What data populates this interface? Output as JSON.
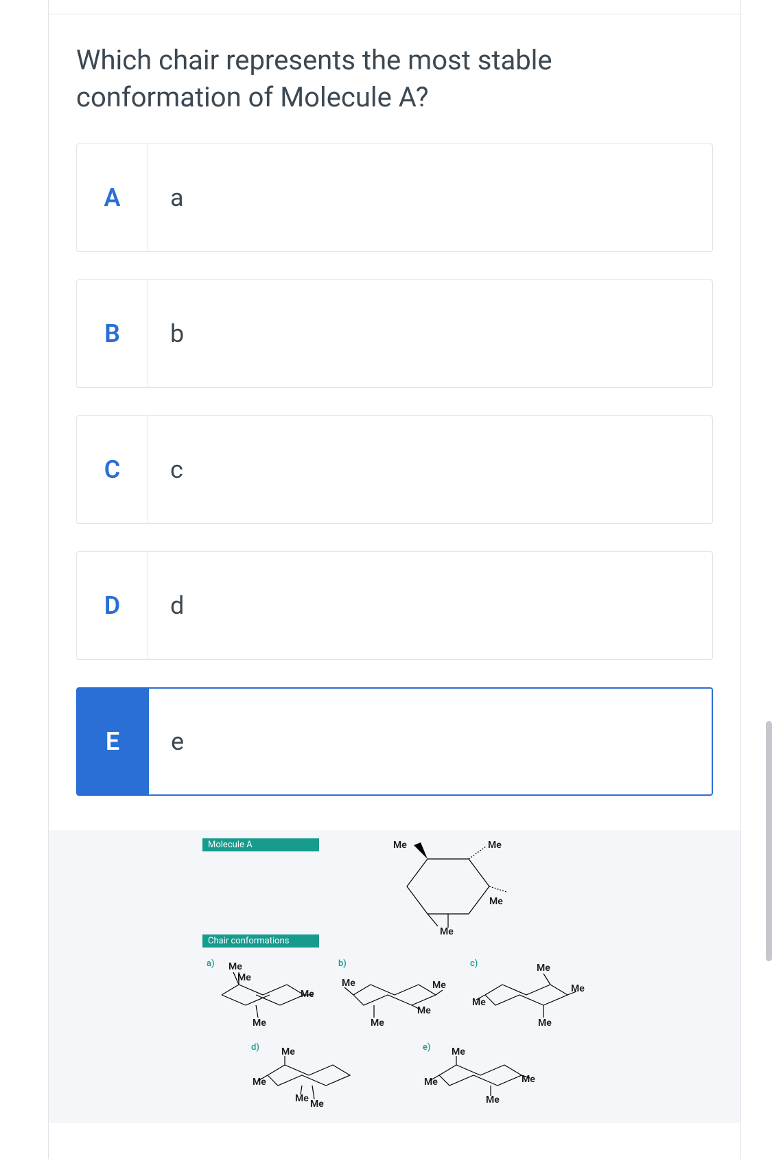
{
  "question": "Which chair represents the most stable conformation of Molecule A?",
  "options": [
    {
      "letter": "A",
      "text": "a",
      "selected": false
    },
    {
      "letter": "B",
      "text": "b",
      "selected": false
    },
    {
      "letter": "C",
      "text": "c",
      "selected": false
    },
    {
      "letter": "D",
      "text": "d",
      "selected": false
    },
    {
      "letter": "E",
      "text": "e",
      "selected": true
    }
  ],
  "figure": {
    "moleculeLabel": "Molecule A",
    "chairLabel": "Chair conformations",
    "substituent": "Me",
    "chairs": [
      {
        "id": "a",
        "letter": "a)"
      },
      {
        "id": "b",
        "letter": "b)"
      },
      {
        "id": "c",
        "letter": "c)"
      },
      {
        "id": "d",
        "letter": "d)"
      },
      {
        "id": "e",
        "letter": "e)"
      }
    ]
  }
}
